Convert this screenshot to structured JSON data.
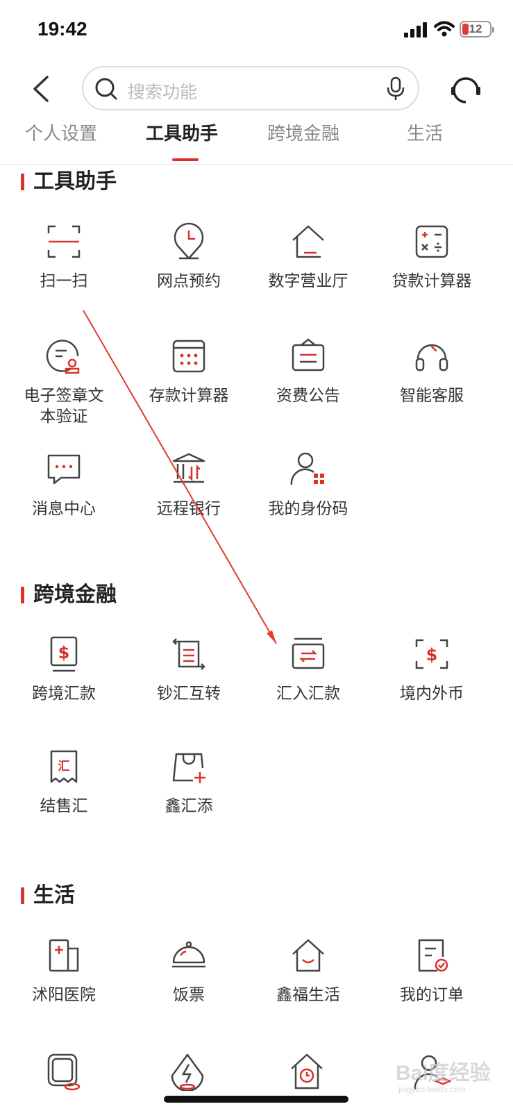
{
  "status": {
    "time": "19:42",
    "battery": "12"
  },
  "search": {
    "placeholder": "搜索功能"
  },
  "tabs": [
    {
      "label": "个人设置"
    },
    {
      "label": "工具助手"
    },
    {
      "label": "跨境金融"
    },
    {
      "label": "生活"
    }
  ],
  "sections": {
    "tools": {
      "title": "工具助手",
      "items": [
        {
          "label": "扫一扫",
          "icon": "scan-icon"
        },
        {
          "label": "网点预约",
          "icon": "location-clock-icon"
        },
        {
          "label": "数字营业厅",
          "icon": "house-icon"
        },
        {
          "label": "贷款计算器",
          "icon": "calculator-icon"
        },
        {
          "label": "电子签章文本验证",
          "icon": "seal-verify-icon"
        },
        {
          "label": "存款计算器",
          "icon": "calendar-grid-icon"
        },
        {
          "label": "资费公告",
          "icon": "notice-board-icon"
        },
        {
          "label": "智能客服",
          "icon": "headset-icon"
        },
        {
          "label": "消息中心",
          "icon": "message-icon"
        },
        {
          "label": "远程银行",
          "icon": "bank-icon"
        },
        {
          "label": "我的身份码",
          "icon": "person-qr-icon"
        }
      ]
    },
    "cross_border": {
      "title": "跨境金融",
      "items": [
        {
          "label": "跨境汇款",
          "icon": "dollar-doc-icon"
        },
        {
          "label": "钞汇互转",
          "icon": "exchange-icon"
        },
        {
          "label": "汇入汇款",
          "icon": "inbound-transfer-icon"
        },
        {
          "label": "境内外币",
          "icon": "dollar-exchange-icon"
        },
        {
          "label": "结售汇",
          "icon": "receipt-icon",
          "glyph": "汇"
        },
        {
          "label": "鑫汇添",
          "icon": "bag-plus-icon"
        }
      ]
    },
    "life": {
      "title": "生活",
      "items": [
        {
          "label": "沭阳医院",
          "icon": "hospital-icon"
        },
        {
          "label": "饭票",
          "icon": "dish-cover-icon"
        },
        {
          "label": "鑫福生活",
          "icon": "smile-house-icon"
        },
        {
          "label": "我的订单",
          "icon": "order-icon"
        }
      ]
    }
  },
  "watermark": {
    "main": "Bai度经验",
    "sub": "jingyan.baidu.com"
  },
  "colors": {
    "accent": "#d9322d",
    "text": "#333333",
    "icon_stroke": "#444444"
  }
}
